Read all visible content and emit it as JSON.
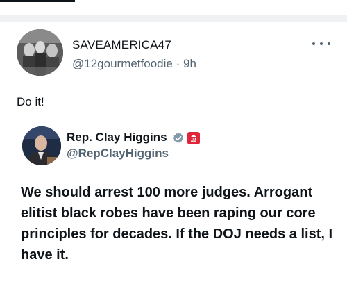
{
  "post": {
    "display_name": "SAVEAMERICA47",
    "handle": "@12gourmetfoodie",
    "separator": "·",
    "time": "9h",
    "text": "Do it!",
    "more_icon": "more-horizontal-icon"
  },
  "quoted": {
    "display_name": "Rep. Clay Higgins",
    "handle": "@RepClayHiggins",
    "verified_icon": "verified-badge-icon",
    "affiliation_icon": "government-badge-icon",
    "text": "We should arrest 100 more judges. Arrogant elitist black robes have been raping our core principles for decades. If the DOJ needs a list, I have it."
  },
  "colors": {
    "text_primary": "#0f1419",
    "text_secondary": "#536471",
    "verified": "#829aab",
    "gov_badge": "#e0243a",
    "divider": "#eff1f3"
  }
}
